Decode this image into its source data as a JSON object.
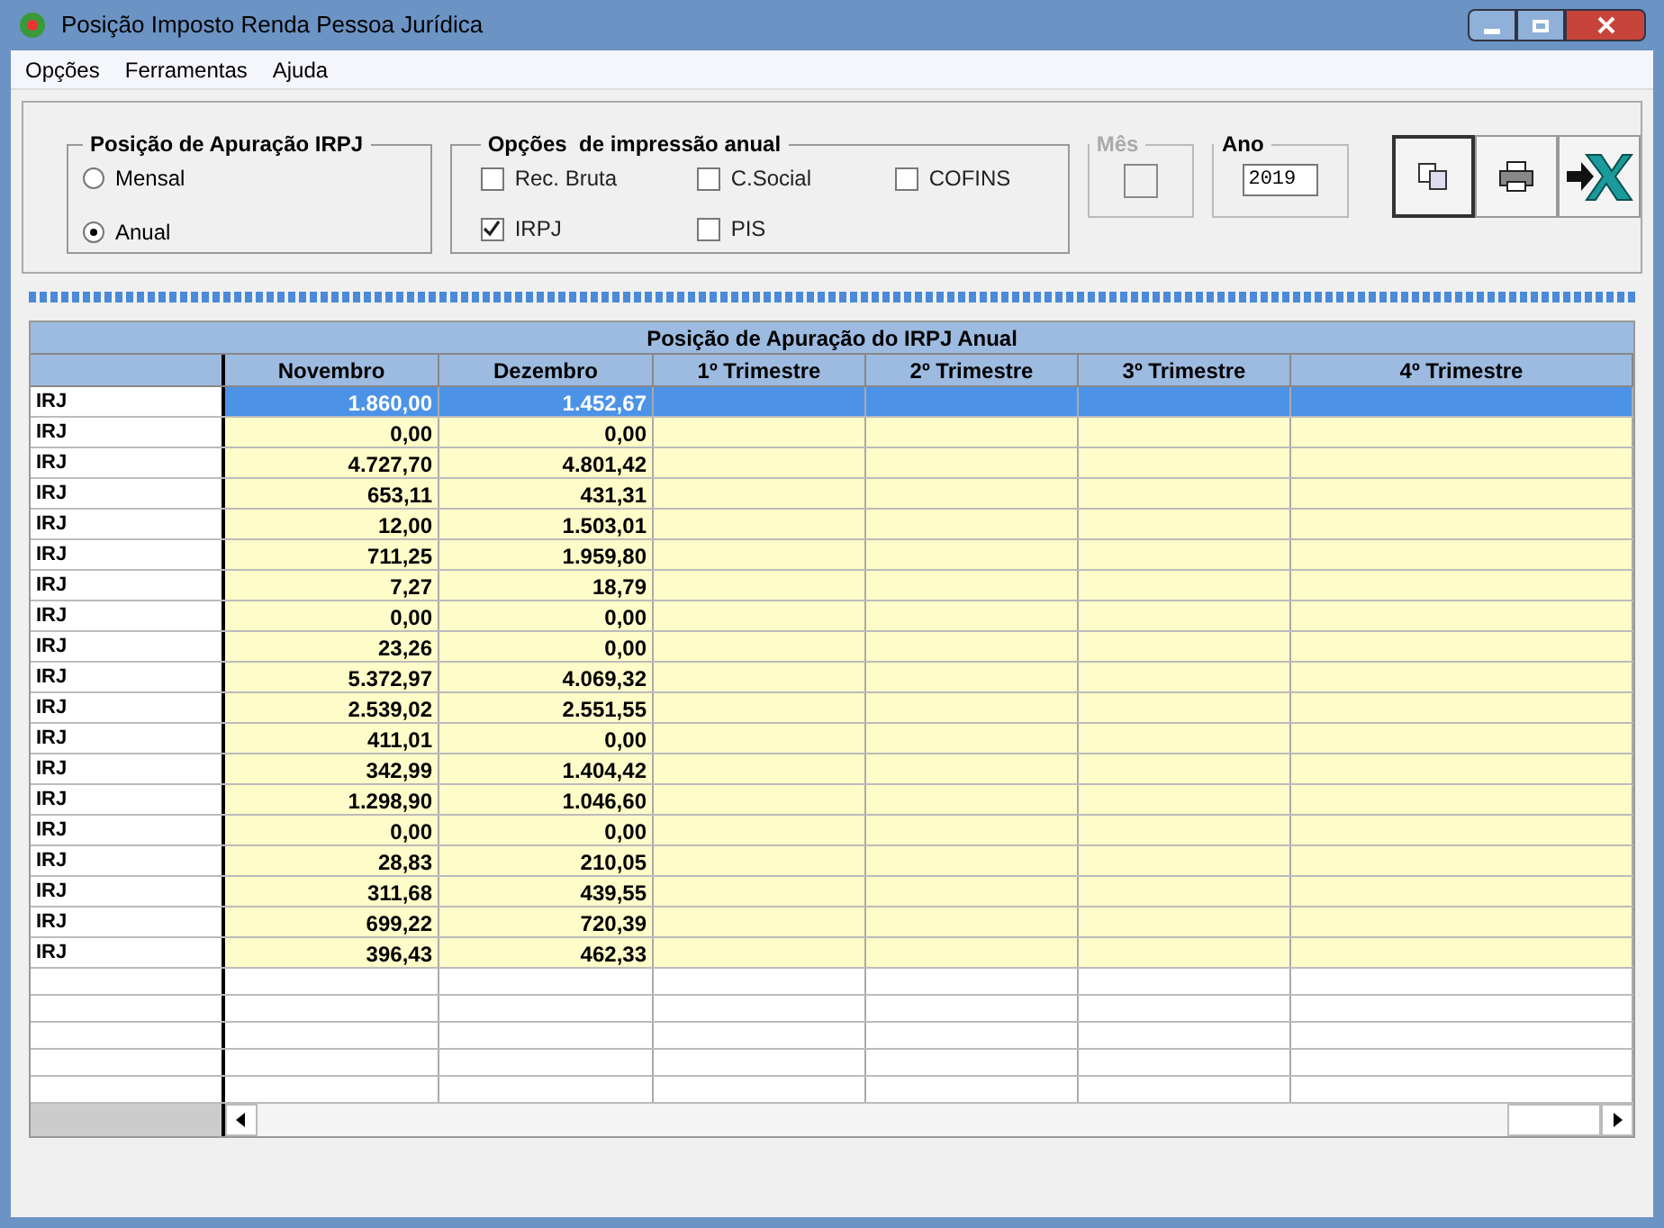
{
  "window": {
    "title": "Posição Imposto Renda Pessoa Jurídica"
  },
  "menu": [
    "Opções",
    "Ferramentas",
    "Ajuda"
  ],
  "position_group": {
    "title": "Posição de Apuração IRPJ",
    "options": [
      {
        "label": "Mensal",
        "selected": false
      },
      {
        "label": "Anual",
        "selected": true
      }
    ]
  },
  "print_group": {
    "title": "Opções  de impressão anual",
    "options": [
      {
        "label": "Rec. Bruta",
        "checked": false
      },
      {
        "label": "C.Social",
        "checked": false
      },
      {
        "label": "COFINS",
        "checked": false
      },
      {
        "label": "IRPJ",
        "checked": true
      },
      {
        "label": "PIS",
        "checked": false
      }
    ]
  },
  "month": {
    "label": "Mês",
    "disabled": true,
    "checked": false
  },
  "progress": {
    "level": 1
  },
  "year": {
    "label": "Ano",
    "value": "2019"
  },
  "table": {
    "title": "Posição de Apuração do IRPJ Anual",
    "columns": [
      "Novembro",
      "Dezembro",
      "1º Trimestre",
      "2º Trimestre",
      "3º Trimestre",
      "4º Trimestre"
    ],
    "rows": [
      {
        "label": "IRJ",
        "values": [
          "1.860,00",
          "1.452,67"
        ],
        "selected": true
      },
      {
        "label": "IRJ",
        "values": [
          "0,00",
          "0,00"
        ],
        "selected": false
      },
      {
        "label": "IRJ",
        "values": [
          "4.727,70",
          "4.801,42"
        ],
        "selected": false
      },
      {
        "label": "IRJ",
        "values": [
          "653,11",
          "431,31"
        ],
        "selected": false
      },
      {
        "label": "IRJ",
        "values": [
          "12,00",
          "1.503,01"
        ],
        "selected": false
      },
      {
        "label": "IRJ",
        "values": [
          "711,25",
          "1.959,80"
        ],
        "selected": false
      },
      {
        "label": "IRJ",
        "values": [
          "7,27",
          "18,79"
        ],
        "selected": false
      },
      {
        "label": "IRJ",
        "values": [
          "0,00",
          "0,00"
        ],
        "selected": false
      },
      {
        "label": "IRJ",
        "values": [
          "23,26",
          "0,00"
        ],
        "selected": false
      },
      {
        "label": "IRJ",
        "values": [
          "5.372,97",
          "4.069,32"
        ],
        "selected": false
      },
      {
        "label": "IRJ",
        "values": [
          "2.539,02",
          "2.551,55"
        ],
        "selected": false
      },
      {
        "label": "IRJ",
        "values": [
          "411,01",
          "0,00"
        ],
        "selected": false
      },
      {
        "label": "IRJ",
        "values": [
          "342,99",
          "1.404,42"
        ],
        "selected": false
      },
      {
        "label": "IRJ",
        "values": [
          "1.298,90",
          "1.046,60"
        ],
        "selected": false
      },
      {
        "label": "IRJ",
        "values": [
          "0,00",
          "0,00"
        ],
        "selected": false
      },
      {
        "label": "IRJ",
        "values": [
          "28,83",
          "210,05"
        ],
        "selected": false
      },
      {
        "label": "IRJ",
        "values": [
          "311,68",
          "439,55"
        ],
        "selected": false
      },
      {
        "label": "IRJ",
        "values": [
          "699,22",
          "720,39"
        ],
        "selected": false
      },
      {
        "label": "IRJ",
        "values": [
          "396,43",
          "462,33"
        ],
        "selected": false
      }
    ]
  }
}
